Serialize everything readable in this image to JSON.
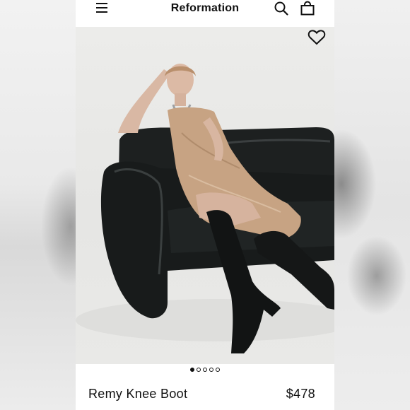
{
  "header": {
    "brand": "Reformation",
    "icons": [
      "menu-icon",
      "search-icon",
      "shopping-bag-icon"
    ]
  },
  "gallery": {
    "favorite_icon": "heart-icon",
    "image_count": 5,
    "active_index": 1
  },
  "product": {
    "name": "Remy Knee Boot",
    "price": "$478"
  },
  "colors": {
    "text": "#111111",
    "background": "#ffffff",
    "photo_background": "#e8e8e6",
    "dress": "#c8a684",
    "sofa": "#1b1e1e"
  }
}
